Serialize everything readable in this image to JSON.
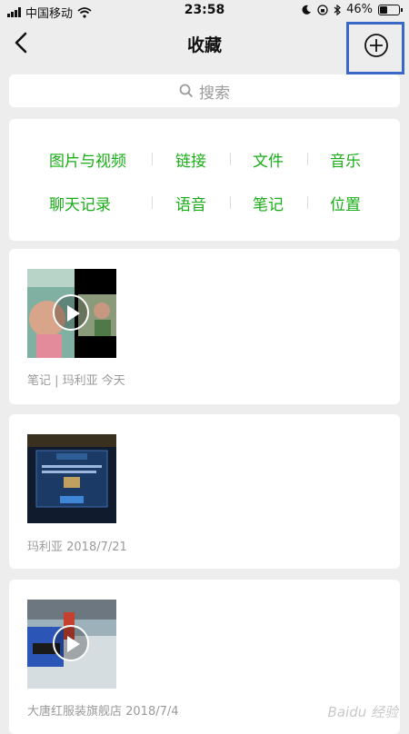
{
  "status_bar": {
    "carrier": "中国移动",
    "time": "23:58",
    "battery_pct": "46%",
    "battery_level": 0.46
  },
  "nav": {
    "title": "收藏"
  },
  "search": {
    "placeholder": "搜索"
  },
  "categories": [
    [
      "图片与视频",
      "链接",
      "文件",
      "音乐"
    ],
    [
      "聊天记录",
      "语音",
      "笔记",
      "位置"
    ]
  ],
  "items": [
    {
      "type": "video",
      "meta": "笔记  |  玛利亚  今天"
    },
    {
      "type": "image",
      "meta": "玛利亚  2018/7/21"
    },
    {
      "type": "video",
      "meta": "大唐红服装旗舰店  2018/7/4"
    }
  ],
  "watermark": "Baidu 经验",
  "colors": {
    "accent_green": "#1aad19",
    "highlight_box": "#3a68c6",
    "background": "#ededed"
  }
}
